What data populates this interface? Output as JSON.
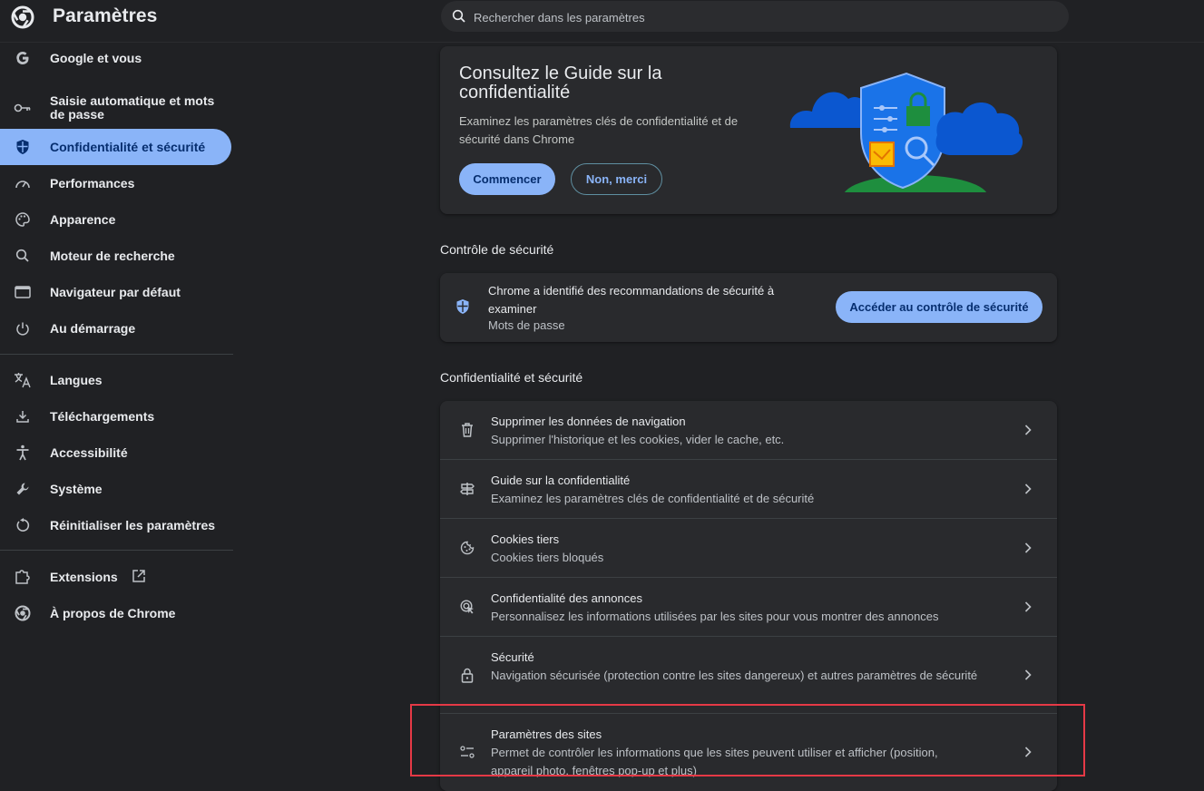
{
  "header": {
    "title": "Paramètres",
    "search_placeholder": "Rechercher dans les paramètres",
    "logo_icon": "chrome-logo-icon",
    "search_icon": "search-icon"
  },
  "sidebar": {
    "items": [
      {
        "label": "Google et vous",
        "icon": "google-icon"
      },
      {
        "label": "Saisie automatique et mots de passe",
        "icon": "key-icon"
      },
      {
        "label": "Confidentialité et sécurité",
        "icon": "shield-icon",
        "active": true
      },
      {
        "label": "Performances",
        "icon": "speedometer-icon"
      },
      {
        "label": "Apparence",
        "icon": "palette-icon"
      },
      {
        "label": "Moteur de recherche",
        "icon": "search-icon"
      },
      {
        "label": "Navigateur par défaut",
        "icon": "browser-window-icon"
      },
      {
        "label": "Au démarrage",
        "icon": "power-icon"
      },
      {
        "label": "Langues",
        "icon": "translate-icon"
      },
      {
        "label": "Téléchargements",
        "icon": "download-icon"
      },
      {
        "label": "Accessibilité",
        "icon": "accessibility-icon"
      },
      {
        "label": "Système",
        "icon": "wrench-icon"
      },
      {
        "label": "Réinitialiser les paramètres",
        "icon": "reset-icon"
      },
      {
        "label": "Extensions",
        "icon": "puzzle-icon"
      },
      {
        "label": "À propos de Chrome",
        "icon": "chrome-icon"
      }
    ]
  },
  "guide_card": {
    "title": "Consultez le Guide sur la confidentialité",
    "description": "Examinez les paramètres clés de confidentialité et de sécurité dans Chrome",
    "primary_button": "Commencer",
    "secondary_button": "Non, merci"
  },
  "safety_check": {
    "section_title": "Contrôle de sécurité",
    "title": "Chrome a identifié des recommandations de sécurité à examiner",
    "subtitle": "Mots de passe",
    "button": "Accéder au contrôle de sécurité"
  },
  "privacy": {
    "section_title": "Confidentialité et sécurité",
    "rows": [
      {
        "title": "Supprimer les données de navigation",
        "subtitle": "Supprimer l'historique et les cookies, vider le cache, etc.",
        "icon": "trash-icon"
      },
      {
        "title": "Guide sur la confidentialité",
        "subtitle": "Examinez les paramètres clés de confidentialité et de sécurité",
        "icon": "signpost-icon"
      },
      {
        "title": "Cookies tiers",
        "subtitle": "Cookies tiers bloqués",
        "icon": "cookie-icon"
      },
      {
        "title": "Confidentialité des annonces",
        "subtitle": "Personnalisez les informations utilisées par les sites pour vous montrer des annonces",
        "icon": "ad-privacy-icon"
      },
      {
        "title": "Sécurité",
        "subtitle": "Navigation sécurisée (protection contre les sites dangereux) et autres paramètres de sécurité",
        "icon": "lock-icon"
      },
      {
        "title": "Paramètres des sites",
        "subtitle": "Permet de contrôler les informations que les sites peuvent utiliser et afficher (position, appareil photo, fenêtres pop-up et plus)",
        "icon": "tune-icon"
      }
    ]
  },
  "colors": {
    "background": "#202124",
    "card": "#292a2d",
    "accent": "#8ab4f8",
    "highlight_box": "#e53946"
  }
}
